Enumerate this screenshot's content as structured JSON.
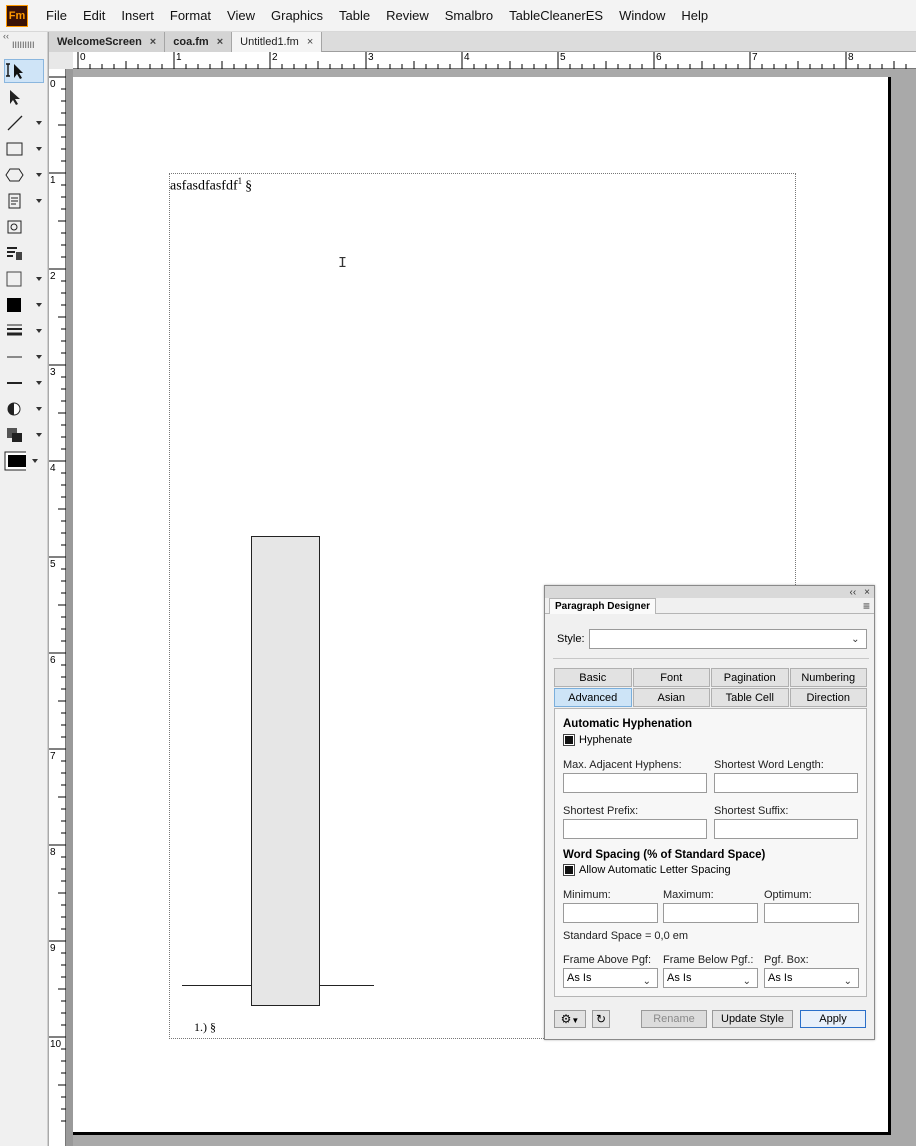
{
  "app": {
    "logo": "Fm",
    "accent": "#ff9a00"
  },
  "menu": [
    "File",
    "Edit",
    "Insert",
    "Format",
    "View",
    "Graphics",
    "Table",
    "Review",
    "Smalbro",
    "TableCleanerES",
    "Window",
    "Help"
  ],
  "toolbar": {
    "collapse": "‹‹",
    "grip": "IIIIIIIII"
  },
  "tabs": [
    {
      "label": "WelcomeScreen",
      "close": "×"
    },
    {
      "label": "coa.fm",
      "close": "×"
    },
    {
      "label": "Untitled1.fm",
      "close": "×"
    }
  ],
  "ruler": {
    "top": [
      "0",
      "1",
      "2",
      "3",
      "4",
      "5",
      "6",
      "7",
      "8"
    ],
    "left": [
      "0",
      "1",
      "2",
      "3",
      "4",
      "5",
      "6",
      "7",
      "8",
      "9",
      "10"
    ]
  },
  "document": {
    "text": "asfasdfasfdf",
    "superscript": "1",
    "end_mark": "§",
    "footnote": "1.) §",
    "cursor": "I"
  },
  "panel": {
    "title": "Paragraph Designer",
    "titlebar_collapse": "‹‹",
    "titlebar_close": "×",
    "menu_icon": "≡",
    "style_label": "Style:",
    "style_value": "",
    "tabs_row1": [
      "Basic",
      "Font",
      "Pagination",
      "Numbering"
    ],
    "tabs_row2": [
      "Advanced",
      "Asian",
      "Table Cell",
      "Direction"
    ],
    "active_tab": "Advanced",
    "hyphenation_title": "Automatic Hyphenation",
    "hyphenate_label": "Hyphenate",
    "max_adjacent_label": "Max. Adjacent Hyphens:",
    "shortest_word_label": "Shortest Word Length:",
    "shortest_prefix_label": "Shortest Prefix:",
    "shortest_suffix_label": "Shortest Suffix:",
    "word_spacing_title": "Word Spacing (% of Standard Space)",
    "letter_spacing_label": "Allow Automatic Letter Spacing",
    "minimum_label": "Minimum:",
    "maximum_label": "Maximum:",
    "optimum_label": "Optimum:",
    "standard_space": "Standard Space = 0,0 em",
    "frame_above_label": "Frame Above Pgf:",
    "frame_below_label": "Frame Below Pgf.:",
    "pgf_box_label": "Pgf. Box:",
    "frame_above_value": "As Is",
    "frame_below_value": "As Is",
    "pgf_box_value": "As Is",
    "rename": "Rename",
    "update_style": "Update Style",
    "apply": "Apply"
  }
}
